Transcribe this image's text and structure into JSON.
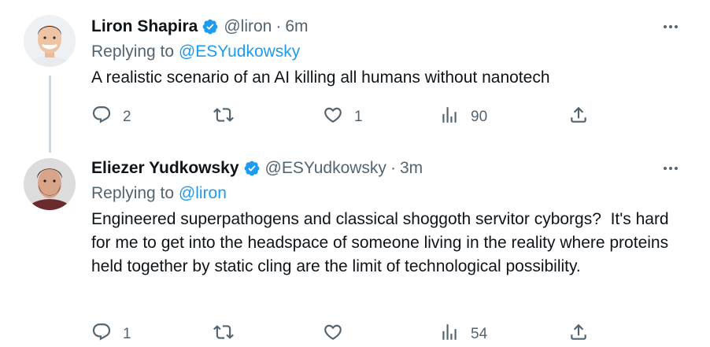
{
  "colors": {
    "accent": "#1d9bf0",
    "text": "#0f1419",
    "secondary": "#536471",
    "line": "#cfd9de"
  },
  "tweets": [
    {
      "author_name": "Liron Shapira",
      "handle": "@liron",
      "separator": "·",
      "time": "6m",
      "replying_prefix": "Replying to ",
      "replying_to": "@ESYudkowsky",
      "text": "A realistic scenario of an AI killing all humans without nanotech",
      "reply_count": "2",
      "retweet_count": "",
      "like_count": "1",
      "view_count": "90"
    },
    {
      "author_name": "Eliezer Yudkowsky",
      "handle": "@ESYudkowsky",
      "separator": "·",
      "time": "3m",
      "replying_prefix": "Replying to ",
      "replying_to": "@liron",
      "text": "Engineered superpathogens and classical shoggoth servitor cyborgs?  It's hard for me to get into the headspace of someone living in the reality where proteins held together by static cling are the limit of technological possibility.",
      "reply_count": "1",
      "retweet_count": "",
      "like_count": "",
      "view_count": "54"
    }
  ],
  "icons": [
    "verified-badge-icon",
    "more-icon",
    "reply-icon",
    "retweet-icon",
    "like-icon",
    "views-icon",
    "share-icon"
  ]
}
